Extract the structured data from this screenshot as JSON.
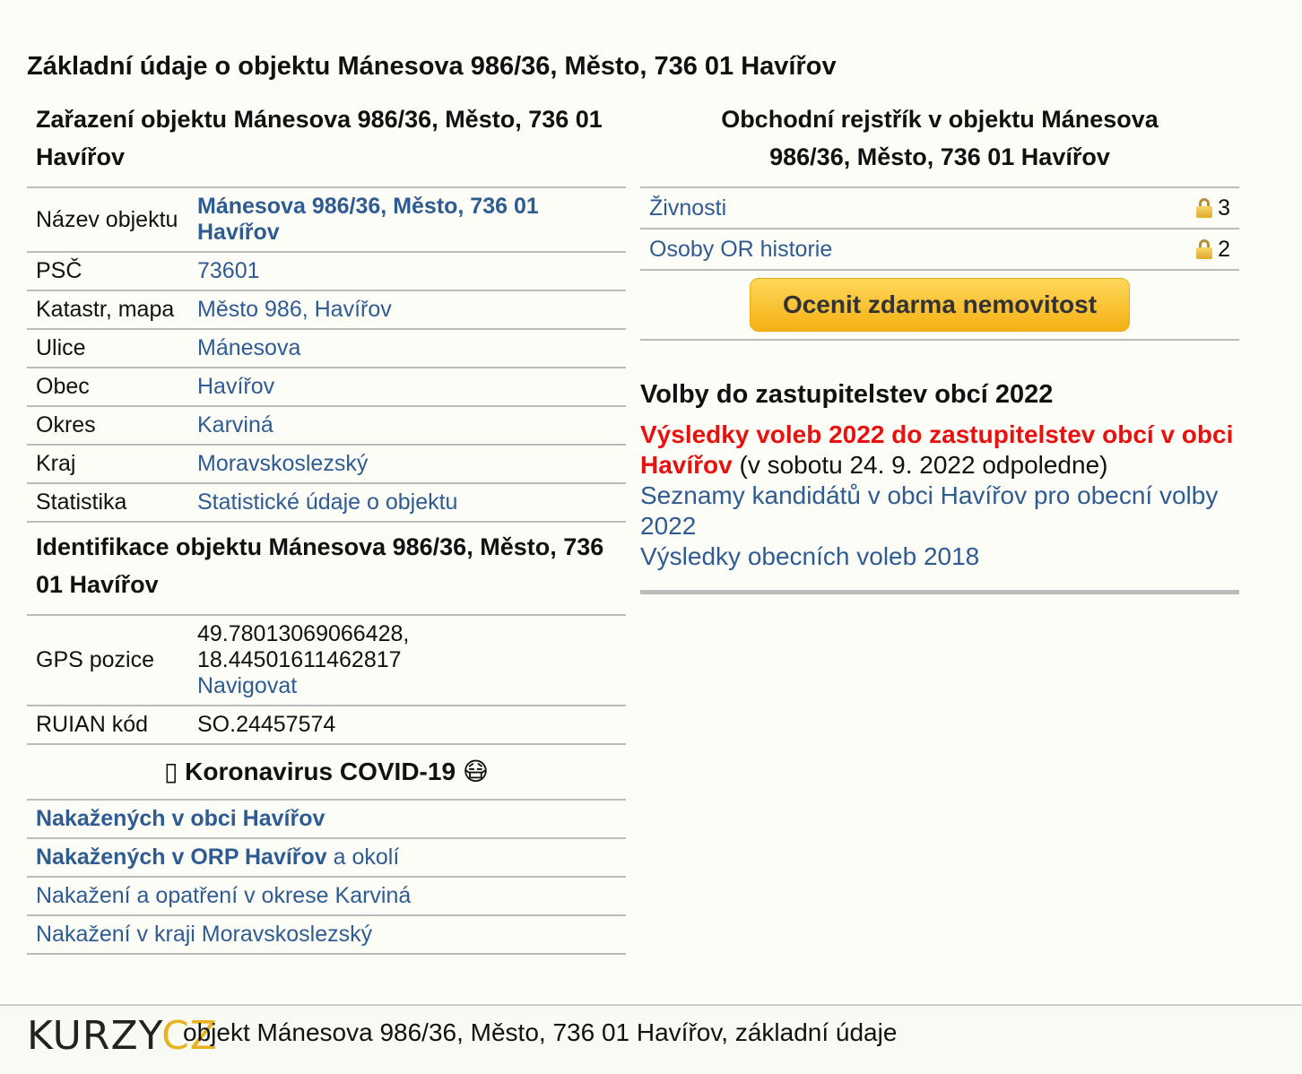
{
  "main_title": "Základní údaje o objektu Mánesova 986/36, Město, 736 01 Havířov",
  "classification": {
    "heading": "Zařazení objektu Mánesova 986/36, Město, 736 01 Havířov",
    "rows": [
      {
        "label": "Název objektu",
        "value": "Mánesova 986/36, Město, 736 01 Havířov"
      },
      {
        "label": "PSČ",
        "value": "73601"
      },
      {
        "label": "Katastr, mapa",
        "value": "Město 986, Havířov"
      },
      {
        "label": "Ulice",
        "value": "Mánesova"
      },
      {
        "label": "Obec",
        "value": "Havířov"
      },
      {
        "label": "Okres",
        "value": "Karviná"
      },
      {
        "label": "Kraj",
        "value": "Moravskoslezský"
      },
      {
        "label": "Statistika",
        "value": "Statistické údaje o objektu"
      }
    ]
  },
  "identification": {
    "heading": "Identifikace objektu Mánesova 986/36, Město, 736 01 Havířov",
    "gps_label": "GPS pozice",
    "gps_lat": "49.78013069066428,",
    "gps_lon": "18.44501611462817",
    "navigate": "Navigovat",
    "ruian_label": "RUIAN kód",
    "ruian_value": "SO.24457574"
  },
  "covid": {
    "heading": "Koronavirus COVID-19",
    "prefix_glyph": "▯",
    "mask_emoji": "😷",
    "rows": [
      {
        "link": "Nakažených v obci Havířov",
        "suffix": ""
      },
      {
        "link": "Nakažených v ORP Havířov",
        "suffix": " a okolí"
      },
      {
        "link": "Nakažení a opatření v okrese Karviná",
        "suffix": ""
      },
      {
        "link": "Nakažení v kraji Moravskoslezský",
        "suffix": ""
      }
    ]
  },
  "business_register": {
    "heading_line1": "Obchodní rejstřík v objektu Mánesova",
    "heading_line2": "986/36, Město, 736 01 Havířov",
    "rows": [
      {
        "label": "Živnosti",
        "count": "3"
      },
      {
        "label": "Osoby OR historie",
        "count": "2"
      }
    ],
    "button_label": "Ocenit zdarma nemovitost"
  },
  "elections": {
    "heading": "Volby do zastupitelstev obcí 2022",
    "results_link": "Výsledky voleb 2022 do zastupitelstev obcí v obci Havířov",
    "results_note": " (v sobotu 24. 9. 2022 odpoledne)",
    "candidates_link": "Seznamy kandidátů v obci Havířov pro obecní volby 2022",
    "results_2018_link": "Výsledky obecních voleb 2018"
  },
  "footer": {
    "logo_part1": "KURZY",
    "logo_part2": "CZ",
    "text": "objekt Mánesova 986/36, Město, 736 01 Havířov, základní údaje"
  },
  "colors": {
    "link": "#2f5b93",
    "highlight_red": "#e8110f",
    "button": "#f5b014",
    "logo_accent": "#e6b421"
  }
}
